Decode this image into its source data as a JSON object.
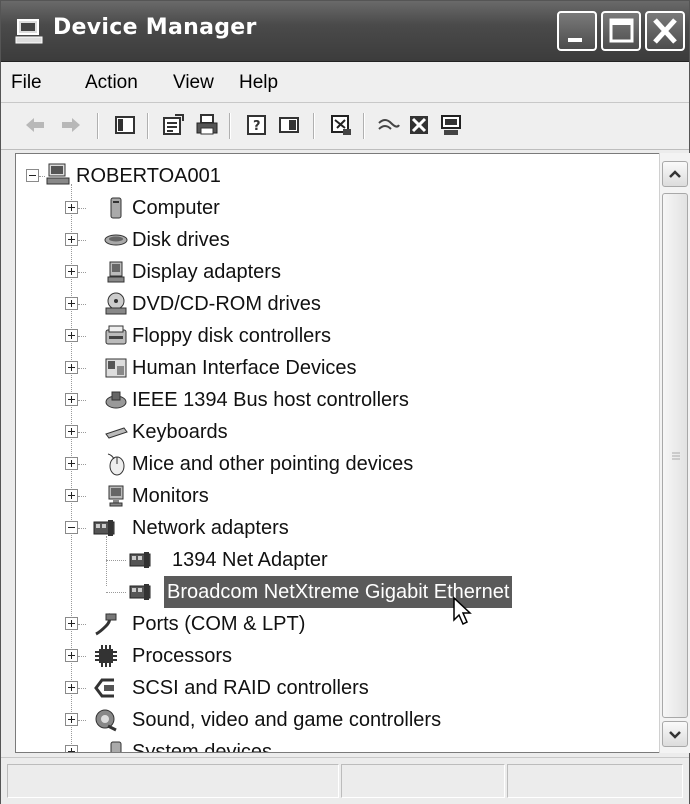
{
  "window": {
    "title": "Device Manager",
    "app_icon": "computer-monitor-icon"
  },
  "title_buttons": [
    {
      "name": "minimize-button",
      "icon": "minimize-icon"
    },
    {
      "name": "maximize-button",
      "icon": "maximize-icon"
    },
    {
      "name": "close-button",
      "icon": "close-icon"
    }
  ],
  "menu": [
    "File",
    "Action",
    "View",
    "Help"
  ],
  "toolbar": [
    "back-arrow-icon",
    "forward-arrow-icon",
    "show-hide-tree-icon",
    "properties-icon",
    "print-icon",
    "help-icon",
    "view-icon",
    "scan-hardware-icon",
    "disable-device-icon",
    "uninstall-device-icon",
    "update-driver-icon"
  ],
  "tree": {
    "root": {
      "label": "ROBERTOA001",
      "icon": "computer-icon",
      "state": "expanded"
    },
    "items": [
      {
        "label": "Computer",
        "icon": "computer-icon",
        "state": "collapsed"
      },
      {
        "label": "Disk drives",
        "icon": "disk-drive-icon",
        "state": "collapsed"
      },
      {
        "label": "Display adapters",
        "icon": "display-adapter-icon",
        "state": "collapsed"
      },
      {
        "label": "DVD/CD-ROM drives",
        "icon": "cdrom-icon",
        "state": "collapsed"
      },
      {
        "label": "Floppy disk controllers",
        "icon": "floppy-controller-icon",
        "state": "collapsed"
      },
      {
        "label": "Human Interface Devices",
        "icon": "hid-icon",
        "state": "collapsed"
      },
      {
        "label": "IEEE 1394 Bus host controllers",
        "icon": "firewire-icon",
        "state": "collapsed"
      },
      {
        "label": "Keyboards",
        "icon": "keyboard-icon",
        "state": "collapsed"
      },
      {
        "label": "Mice and other pointing devices",
        "icon": "mouse-icon",
        "state": "collapsed"
      },
      {
        "label": "Monitors",
        "icon": "monitor-icon",
        "state": "collapsed"
      },
      {
        "label": "Network adapters",
        "icon": "network-adapter-icon",
        "state": "expanded",
        "children": [
          {
            "label": "1394 Net Adapter",
            "icon": "network-adapter-icon",
            "selected": false
          },
          {
            "label": "Broadcom NetXtreme Gigabit Ethernet",
            "icon": "network-adapter-icon",
            "selected": true
          }
        ]
      },
      {
        "label": "Ports (COM & LPT)",
        "icon": "port-icon",
        "state": "collapsed"
      },
      {
        "label": "Processors",
        "icon": "processor-icon",
        "state": "collapsed"
      },
      {
        "label": "SCSI and RAID controllers",
        "icon": "scsi-icon",
        "state": "collapsed"
      },
      {
        "label": "Sound, video and game controllers",
        "icon": "sound-icon",
        "state": "collapsed"
      },
      {
        "label": "System devices",
        "icon": "system-device-icon",
        "state": "collapsed"
      }
    ]
  },
  "colors": {
    "selection": "#5a5a5a",
    "titlebar": "#4a4a4a"
  }
}
